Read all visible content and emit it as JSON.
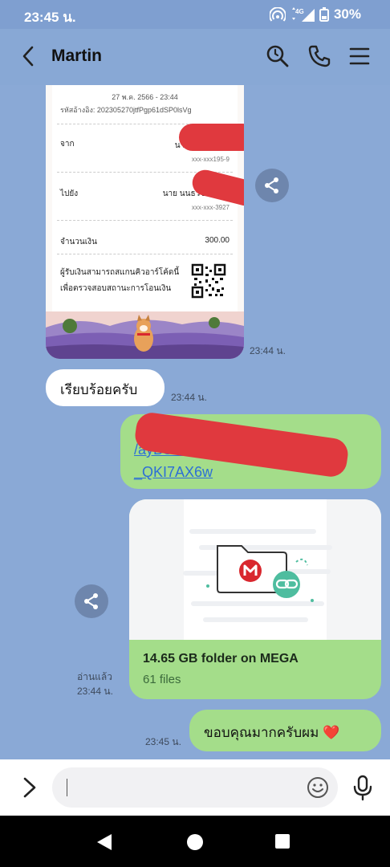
{
  "status_bar": {
    "time": "23:45 น.",
    "network": "4G",
    "battery": "30%"
  },
  "header": {
    "title": "Martin",
    "icons": [
      "back-icon",
      "search-icon",
      "phone-icon",
      "menu-icon"
    ]
  },
  "receipt": {
    "date": "27 พ.ค. 2566 - 23:44",
    "ref": "รหัสอ้างอิง: 202305270jtfPgp61dSP0lsVg",
    "from_label": "จาก",
    "from_name": "นาย",
    "from_account": "xxx-xxx195-9",
    "to_label": "ไปยัง",
    "to_name": "นาย นนธวัช",
    "to_account": "xxx-xxx-3927",
    "amount_label": "จำนวนเงิน",
    "amount": "300.00",
    "note": "ผู้รับเงินสามารถสแกนคิวอาร์โค้ดนี้ เพื่อตรวจสอบสถานะการโอนเงิน",
    "time": "23:44 น."
  },
  "messages": [
    {
      "text": "เรียบร้อยครับ",
      "time": "23:44 น."
    },
    {
      "link": "/ayBSVZ5Y#iQJudjaI6g\n_QKI7AX6w"
    },
    {
      "text": "ขอบคุณมากครับผม ❤️",
      "time": "23:45 น."
    }
  ],
  "mega_card": {
    "title": "14.65 GB folder on MEGA",
    "subtitle": "61 files",
    "read": "อ่านแล้ว",
    "time": "23:44 น."
  },
  "input": {
    "placeholder": ""
  },
  "colors": {
    "background": "#8aa9d6",
    "outgoing": "#a4dd8a",
    "incoming": "#ffffff",
    "link": "#2d6fd6",
    "mega_red": "#d9272e"
  }
}
